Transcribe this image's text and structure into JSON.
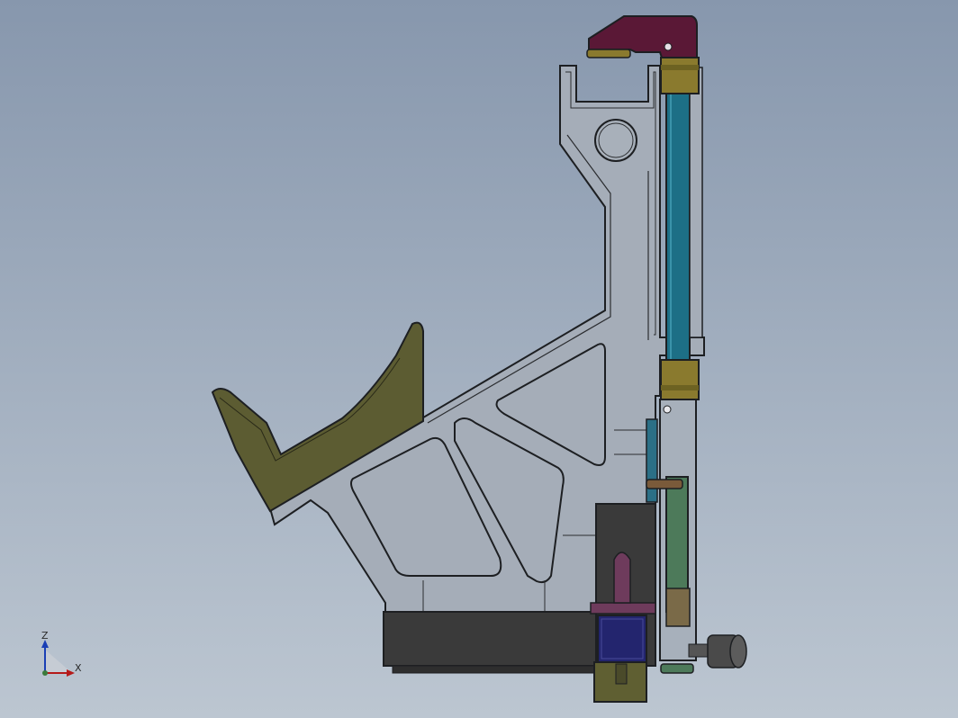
{
  "viewport": {
    "background_top": "#8797ad",
    "background_bottom": "#bcc6d1"
  },
  "model": {
    "frame_color": "#a5adb8",
    "edge_color": "#1d1f22",
    "clamp_color": "#5a1836",
    "pad_color": "#5c5c32",
    "rod_color": "#1d6f86",
    "bushing_color": "#8a7a2e",
    "base_color": "#3a3a3a",
    "cylinder_color": "#23256e",
    "cylinder_body_color": "#5f5f32",
    "lower_rod_color": "#4d7a5a",
    "motor_color": "#4a4a4a",
    "knob_color": "#6e3b5c"
  },
  "triad": {
    "z_label": "Z",
    "x_label": "X",
    "z_color": "#1a3fb5",
    "x_color": "#b51a1a"
  }
}
